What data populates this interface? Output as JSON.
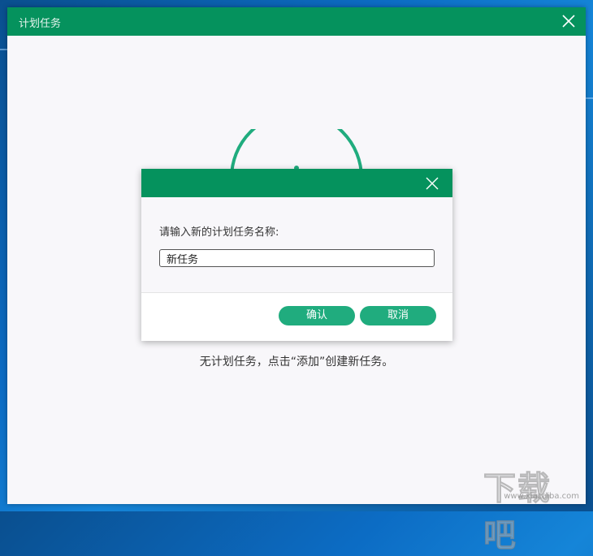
{
  "window": {
    "title": "计划任务",
    "empty_message": "无计划任务，点击“添加”创建新任务。"
  },
  "dialog": {
    "prompt": "请输入新的计划任务名称:",
    "input_value": "新任务",
    "ok_label": "确认",
    "cancel_label": "取消"
  },
  "watermark": {
    "text": "下载吧",
    "url": "www.xiazaiba.com"
  },
  "colors": {
    "titlebar": "#05925d",
    "button": "#20ac7e",
    "graphic": "#20ac7e"
  }
}
